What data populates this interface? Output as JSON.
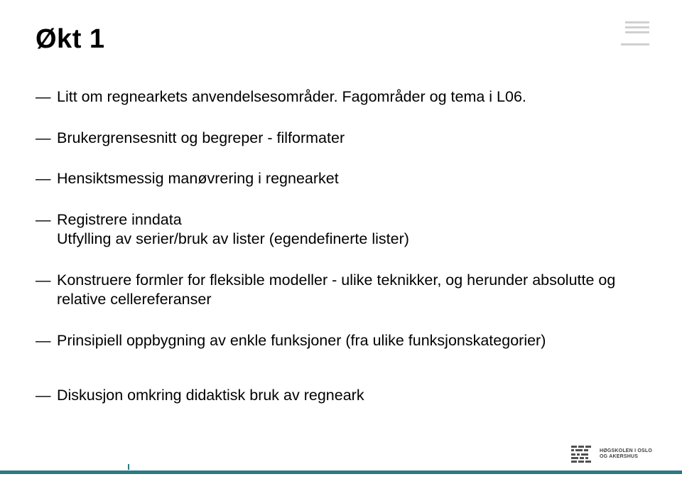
{
  "title": "Økt 1",
  "bullets": [
    {
      "text": "Litt om regnearkets anvendelsesområder. Fagområder og tema i L06."
    },
    {
      "text": "Brukergrensesnitt og begreper - filformater"
    },
    {
      "text": "Hensiktsmessig manøvrering i regnearket"
    },
    {
      "text": "Registrere inndata",
      "sub": "Utfylling av serier/bruk av lister (egendefinerte lister)"
    },
    {
      "text": "Konstruere formler for fleksible modeller - ulike teknikker, og herunder absolutte og relative cellereferanser"
    },
    {
      "text": "Prinsipiell oppbygning av enkle funksjoner (fra ulike funksjonskategorier)"
    },
    {
      "text": "Diskusjon omkring didaktisk bruk av regneark"
    }
  ],
  "logo": {
    "line1": "HØGSKOLEN I OSLO",
    "line2": "OG AKERSHUS"
  }
}
